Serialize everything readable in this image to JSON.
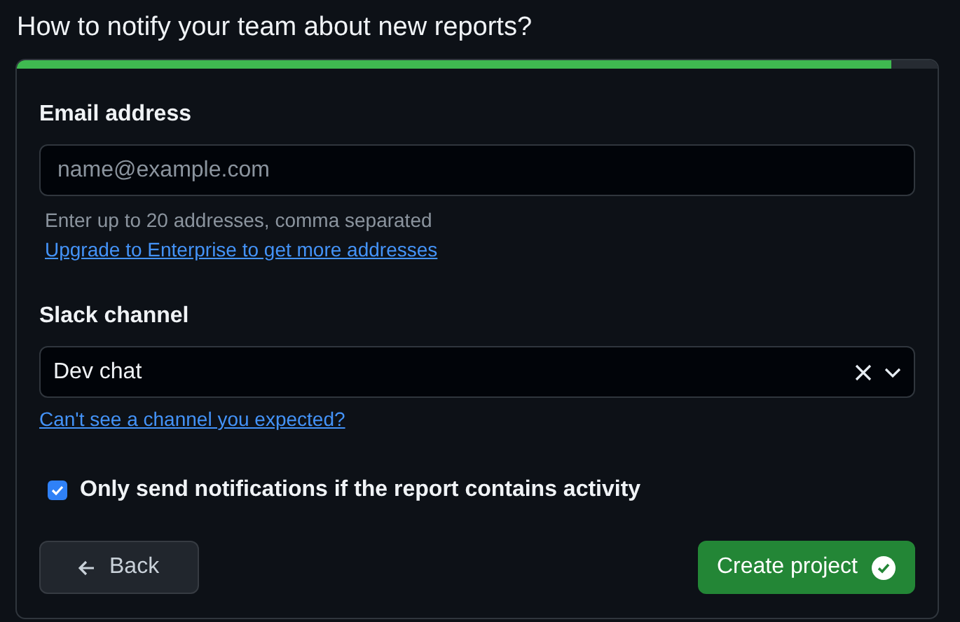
{
  "title": "How to notify your team about new reports?",
  "progress": {
    "level": 0.95
  },
  "email": {
    "label": "Email address",
    "placeholder": "name@example.com",
    "help": "Enter up to 20 addresses, comma separated",
    "link": "Upgrade to Enterprise to get more addresses"
  },
  "slack": {
    "label": "Slack channel",
    "value": "Dev chat",
    "link": "Can't see a channel you expected?"
  },
  "option": {
    "label": "Only send notifications if the report contains activity",
    "checked": true
  },
  "buttons": [
    {
      "kind": "back",
      "label": "Back"
    },
    {
      "kind": "create",
      "label": "Create project"
    }
  ]
}
